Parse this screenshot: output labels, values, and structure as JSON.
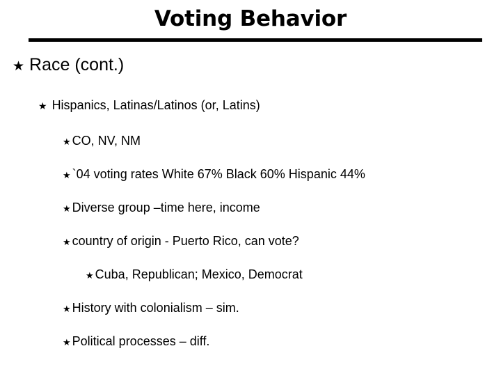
{
  "slide": {
    "title": "Voting Behavior",
    "bullet_glyph": "★",
    "bullet_icon_name": "star-bullet-icon",
    "accent_color": "#000000",
    "background_color": "#ffffff",
    "divider_color": "#000000",
    "items": [
      {
        "level": 1,
        "text": "Race (cont.)"
      },
      {
        "level": 2,
        "text": "Hispanics, Latinas/Latinos (or, Latins)"
      },
      {
        "level": 3,
        "text": "CO, NV, NM"
      },
      {
        "level": 3,
        "text": "`04 voting rates   White 67%   Black 60%   Hispanic 44%"
      },
      {
        "level": 3,
        "text": "Diverse group –time here, income"
      },
      {
        "level": 3,
        "text": "country of origin - Puerto Rico, can vote?"
      },
      {
        "level": 4,
        "text": "Cuba, Republican; Mexico, Democrat"
      },
      {
        "level": 3,
        "text": "History with colonialism – sim."
      },
      {
        "level": 3,
        "text": "Political processes – diff."
      }
    ]
  }
}
